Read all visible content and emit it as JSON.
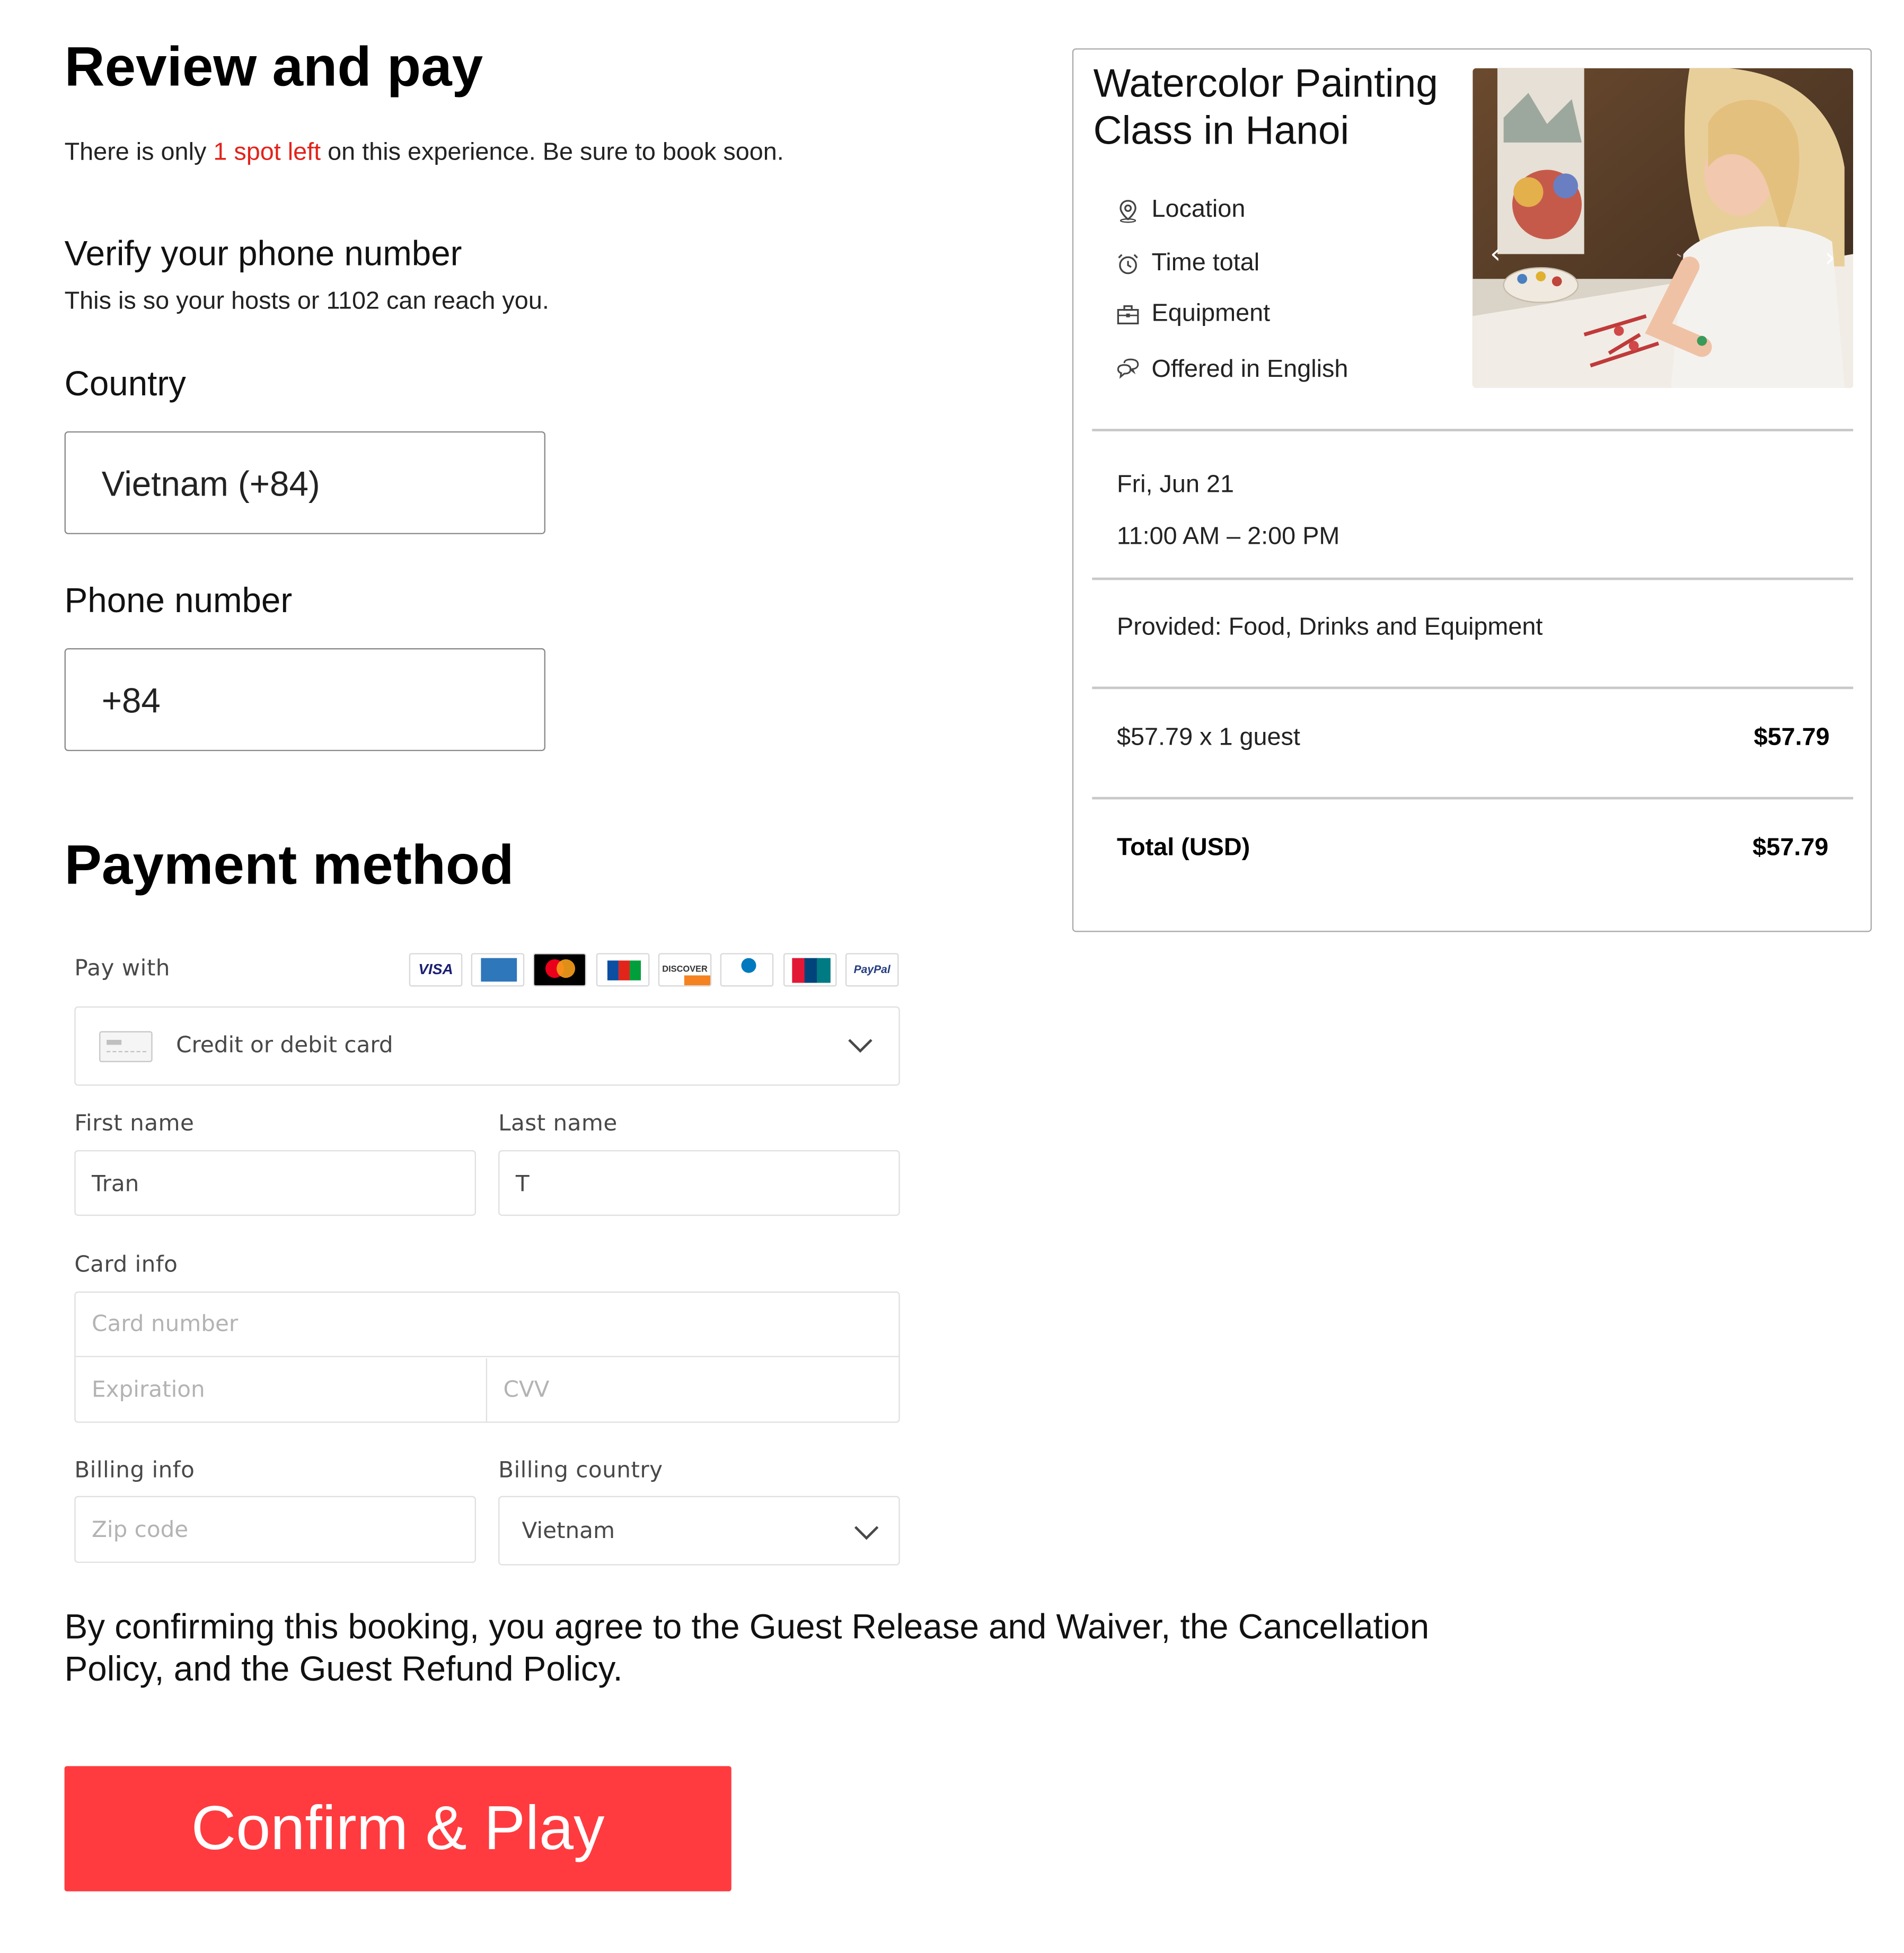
{
  "page": {
    "title": "Review and pay",
    "notice_prefix": "There is only ",
    "notice_highlight": "1 spot left",
    "notice_suffix": " on this experience. Be sure to book soon."
  },
  "verify": {
    "heading": "Verify your phone number",
    "subtext": "This is so your hosts or 1102 can reach you.",
    "country_label": "Country",
    "country_value": "Vietnam (+84)",
    "phone_label": "Phone number",
    "phone_value": "+84"
  },
  "payment": {
    "heading": "Payment method",
    "pay_with_label": "Pay with",
    "card_brands": [
      "VISA",
      "AMEX",
      "mastercard",
      "JCB",
      "DISCOVER",
      "Diners Club",
      "UnionPay",
      "PayPal"
    ],
    "method_value": "Credit or debit card",
    "first_name_label": "First name",
    "first_name_value": "Tran",
    "last_name_label": "Last name",
    "last_name_value": "T",
    "card_info_label": "Card info",
    "card_number_placeholder": "Card number",
    "expiration_placeholder": "Expiration",
    "cvv_placeholder": "CVV",
    "billing_info_label": "Billing info",
    "zip_placeholder": "Zip code",
    "billing_country_label": "Billing country",
    "billing_country_value": "Vietnam"
  },
  "agreement": {
    "line1": "By confirming this booking, you agree to the Guest Release and Waiver, the Cancellation",
    "line2": "Policy, and the Guest Refund Policy."
  },
  "confirm_button": "Confirm & Play",
  "summary": {
    "title_line1": "Watercolor Painting",
    "title_line2": "Class in Hanoi",
    "features": [
      {
        "icon": "location-pin-icon",
        "label": "Location"
      },
      {
        "icon": "alarm-clock-icon",
        "label": "Time total"
      },
      {
        "icon": "toolbox-icon",
        "label": "Equipment"
      },
      {
        "icon": "chat-bubbles-icon",
        "label": "Offered in English"
      }
    ],
    "date": "Fri, Jun 21",
    "time": "11:00 AM – 2:00 PM",
    "provided": "Provided: Food, Drinks and Equipment",
    "price_line": "$57.79 x 1 guest",
    "price_amount": "$57.79",
    "total_label": "Total (USD)",
    "total_amount": "$57.79"
  },
  "colors": {
    "accent_red": "#ff3b3f",
    "highlight_red": "#e2231a",
    "border_gray": "#8a8a8a"
  }
}
